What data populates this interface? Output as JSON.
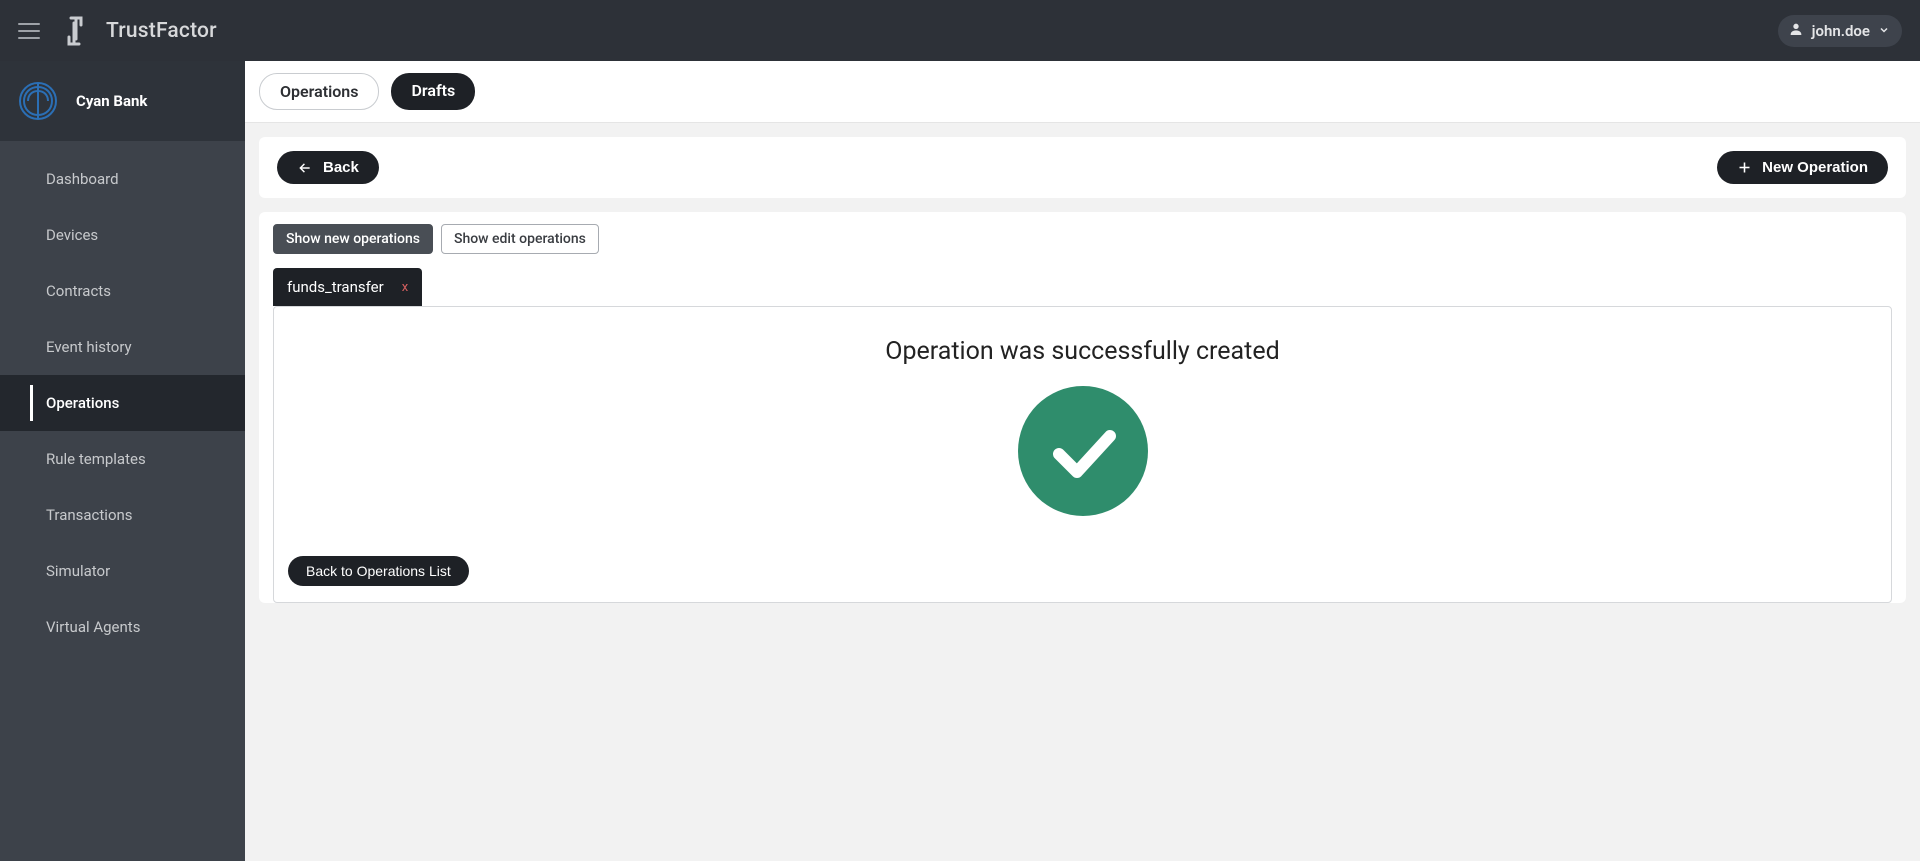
{
  "header": {
    "app_title": "TrustFactor",
    "username": "john.doe"
  },
  "org": {
    "name": "Cyan Bank"
  },
  "sidebar": {
    "items": [
      {
        "label": "Dashboard",
        "active": false
      },
      {
        "label": "Devices",
        "active": false
      },
      {
        "label": "Contracts",
        "active": false
      },
      {
        "label": "Event history",
        "active": false
      },
      {
        "label": "Operations",
        "active": true
      },
      {
        "label": "Rule templates",
        "active": false
      },
      {
        "label": "Transactions",
        "active": false
      },
      {
        "label": "Simulator",
        "active": false
      },
      {
        "label": "Virtual Agents",
        "active": false
      }
    ]
  },
  "tabs": {
    "operations": "Operations",
    "drafts": "Drafts"
  },
  "toolbar": {
    "back": "Back",
    "new_operation": "New Operation"
  },
  "filters": {
    "show_new": "Show new operations",
    "show_edit": "Show edit operations"
  },
  "subtab": {
    "label": "funds_transfer",
    "close": "x"
  },
  "success": {
    "title": "Operation was successfully created",
    "back_list": "Back to Operations List"
  },
  "colors": {
    "success_green": "#2f8d6c",
    "dark": "#1e2126"
  }
}
